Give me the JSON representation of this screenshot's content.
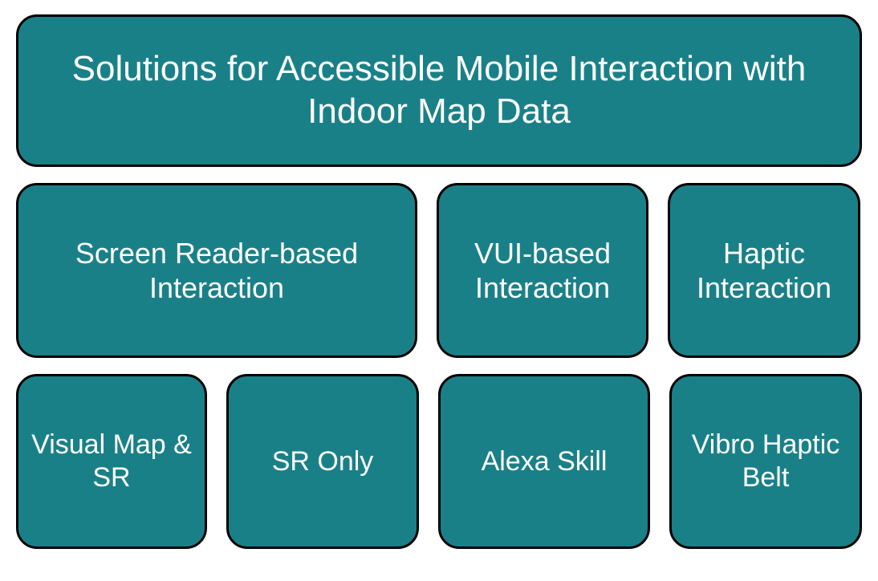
{
  "header": {
    "title": "Solutions for Accessible Mobile Interaction with Indoor Map Data"
  },
  "midRow": {
    "screenReader": "Screen Reader-based Interaction",
    "vui": "VUI-based Interaction",
    "haptic": "Haptic Interaction"
  },
  "botRow": {
    "visualMapSr": "Visual Map & SR",
    "srOnly": "SR Only",
    "alexaSkill": "Alexa Skill",
    "vibroBelt": "Vibro Haptic Belt"
  }
}
